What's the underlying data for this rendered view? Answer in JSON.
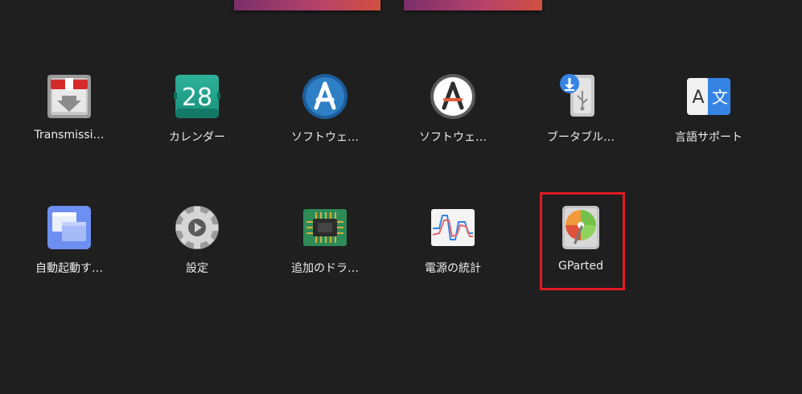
{
  "apps": {
    "transmission": {
      "label": "Transmissi…",
      "icon": "transmission-icon"
    },
    "calendar": {
      "label": "カレンダー",
      "day": "28",
      "icon": "calendar-icon"
    },
    "software": {
      "label": "ソフトウェ…",
      "icon": "software-center-icon"
    },
    "software_updater": {
      "label": "ソフトウェ…",
      "icon": "software-updater-icon"
    },
    "bootable": {
      "label": "ブータブル…",
      "icon": "usb-creator-icon"
    },
    "language": {
      "label": "言語サポート",
      "glyph_latin": "A",
      "glyph_cjk": "文",
      "icon": "language-support-icon"
    },
    "autostart": {
      "label": "自動起動す…",
      "icon": "startup-applications-icon"
    },
    "settings": {
      "label": "設定",
      "icon": "settings-gear-icon"
    },
    "drivers": {
      "label": "追加のドラ…",
      "icon": "additional-drivers-chip-icon"
    },
    "power": {
      "label": "電源の統計",
      "icon": "power-statistics-icon"
    },
    "gparted": {
      "label": "GParted",
      "icon": "gparted-disk-icon"
    }
  },
  "colors": {
    "background": "#1f1f1f",
    "highlight": "#e01b24",
    "label": "#ececec"
  }
}
